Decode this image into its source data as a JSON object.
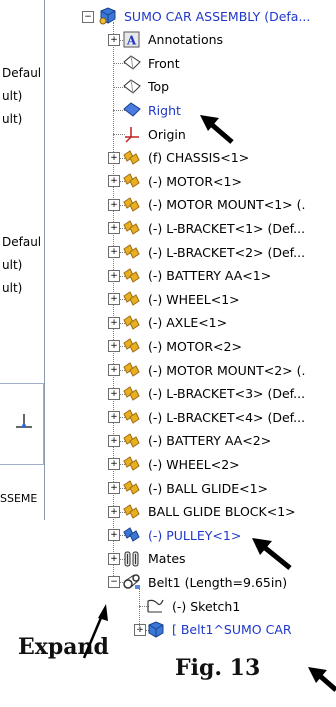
{
  "left_panel": {
    "lines": [
      "Defaul",
      "ult)",
      "ult)",
      "Defaul",
      "ult)",
      "ult)"
    ],
    "bottom_label": "SSEME"
  },
  "tree": {
    "root": "SUMO CAR ASSEMBLY (Defa...",
    "items": [
      {
        "label": "Annotations",
        "icon": "annotations-icon"
      },
      {
        "label": "Front",
        "icon": "plane-icon"
      },
      {
        "label": "Top",
        "icon": "plane-icon"
      },
      {
        "label": "Right",
        "icon": "plane-icon",
        "selected": true
      },
      {
        "label": "Origin",
        "icon": "origin-icon"
      },
      {
        "label": "(f) CHASSIS<1>",
        "icon": "part-icon"
      },
      {
        "label": "(-) MOTOR<1>",
        "icon": "part-icon"
      },
      {
        "label": "(-) MOTOR MOUNT<1> (.",
        "icon": "part-icon"
      },
      {
        "label": "(-) L-BRACKET<1> (Def...",
        "icon": "part-icon"
      },
      {
        "label": "(-) L-BRACKET<2> (Def...",
        "icon": "part-icon"
      },
      {
        "label": "(-) BATTERY AA<1>",
        "icon": "part-icon"
      },
      {
        "label": "(-) WHEEL<1>",
        "icon": "part-icon"
      },
      {
        "label": "(-) AXLE<1>",
        "icon": "part-icon"
      },
      {
        "label": "(-) MOTOR<2>",
        "icon": "part-icon"
      },
      {
        "label": "(-) MOTOR MOUNT<2> (.",
        "icon": "part-icon"
      },
      {
        "label": "(-) L-BRACKET<3> (Def...",
        "icon": "part-icon"
      },
      {
        "label": "(-) L-BRACKET<4> (Def...",
        "icon": "part-icon"
      },
      {
        "label": "(-) BATTERY AA<2>",
        "icon": "part-icon"
      },
      {
        "label": "(-) WHEEL<2>",
        "icon": "part-icon"
      },
      {
        "label": "(-) BALL GLIDE<1>",
        "icon": "part-icon"
      },
      {
        "label": "BALL GLIDE BLOCK<1>",
        "icon": "part-icon"
      },
      {
        "label": "(-) PULLEY<1>",
        "icon": "pulley-part-icon",
        "selected": true
      },
      {
        "label": "Mates",
        "icon": "mates-icon"
      },
      {
        "label": "Belt1 (Length=9.65in)",
        "icon": "belt-icon"
      },
      {
        "label": "(-) Sketch1",
        "icon": "sketch-icon"
      },
      {
        "label": "[ Belt1^SUMO CAR",
        "icon": "subassembly-icon",
        "selected": true
      }
    ]
  },
  "captions": {
    "expand": "Expand",
    "figure": "Fig. 13"
  },
  "colors": {
    "part_yellow": "#e8b020",
    "part_shadow": "#a06c10",
    "selected_blue": "#1f38c8",
    "part_blue": "#3a78d8"
  }
}
